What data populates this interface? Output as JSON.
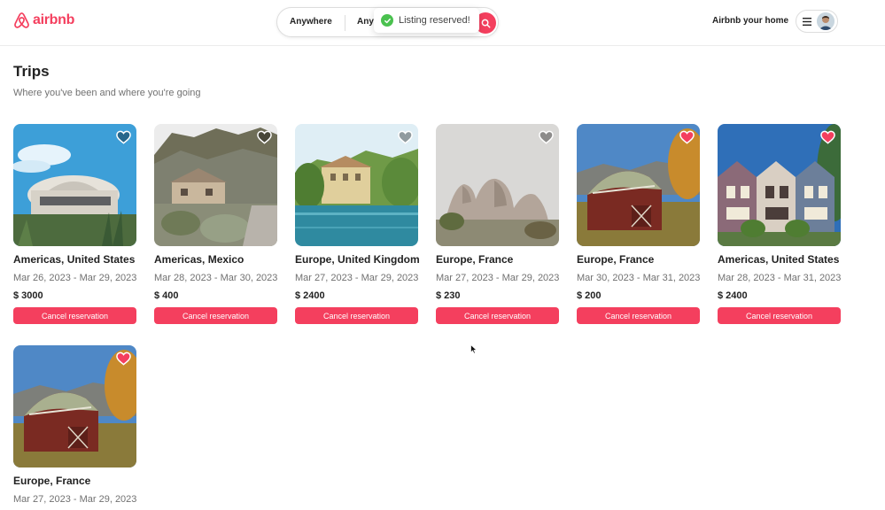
{
  "header": {
    "logo_text": "airbnb",
    "search": {
      "segment_1": "Anywhere",
      "segment_2": "Any"
    },
    "host_link": "Airbnb your home",
    "toast": "Listing reserved!"
  },
  "page": {
    "title": "Trips",
    "subtitle": "Where you've been and where you're going"
  },
  "trips": [
    {
      "location": "Americas, United States",
      "dates": "Mar 26, 2023 - Mar 29, 2023",
      "price": "$ 3000",
      "action": "Cancel reservation",
      "favorited": false
    },
    {
      "location": "Americas, Mexico",
      "dates": "Mar 28, 2023 - Mar 30, 2023",
      "price": "$ 400",
      "action": "Cancel reservation",
      "favorited": false
    },
    {
      "location": "Europe, United Kingdom",
      "dates": "Mar 27, 2023 - Mar 29, 2023",
      "price": "$ 2400",
      "action": "Cancel reservation",
      "favorited": false
    },
    {
      "location": "Europe, France",
      "dates": "Mar 27, 2023 - Mar 29, 2023",
      "price": "$ 230",
      "action": "Cancel reservation",
      "favorited": false
    },
    {
      "location": "Europe, France",
      "dates": "Mar 30, 2023 - Mar 31, 2023",
      "price": "$ 200",
      "action": "Cancel reservation",
      "favorited": true
    },
    {
      "location": "Americas, United States",
      "dates": "Mar 28, 2023 - Mar 31, 2023",
      "price": "$ 2400",
      "action": "Cancel reservation",
      "favorited": true
    },
    {
      "location": "Europe, France",
      "dates": "Mar 27, 2023 - Mar 29, 2023",
      "favorited": true
    }
  ],
  "colors": {
    "brand": "#f43f5e",
    "text": "#222222",
    "muted": "#717171",
    "toast_success": "#4ac14f"
  }
}
